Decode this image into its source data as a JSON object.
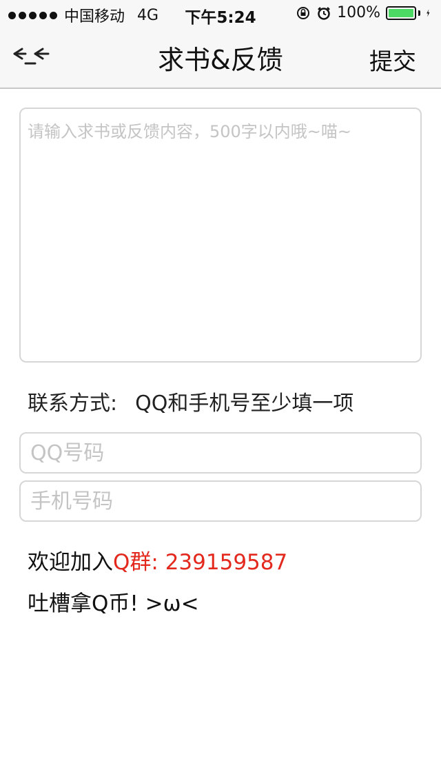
{
  "status_bar": {
    "carrier": "中国移动",
    "network": "4G",
    "time": "下午5:24",
    "battery": "100%",
    "battery_level": 1.0,
    "battery_color": "#4cd964"
  },
  "nav": {
    "back_icon": "back-arrow-icon",
    "title": "求书&反馈",
    "submit_label": "提交"
  },
  "form": {
    "content_placeholder": "请输入求书或反馈内容，500字以内哦~喵~",
    "content_value": "",
    "contact_label": "联系方式:",
    "contact_hint": "QQ和手机号至少填一项",
    "qq_placeholder": "QQ号码",
    "qq_value": "",
    "phone_placeholder": "手机号码",
    "phone_value": ""
  },
  "footer": {
    "join_prefix": "欢迎加入",
    "join_group": "Q群: 239159587",
    "tucao": "吐槽拿Q币! >ω<",
    "accent_color": "#e3281d"
  }
}
